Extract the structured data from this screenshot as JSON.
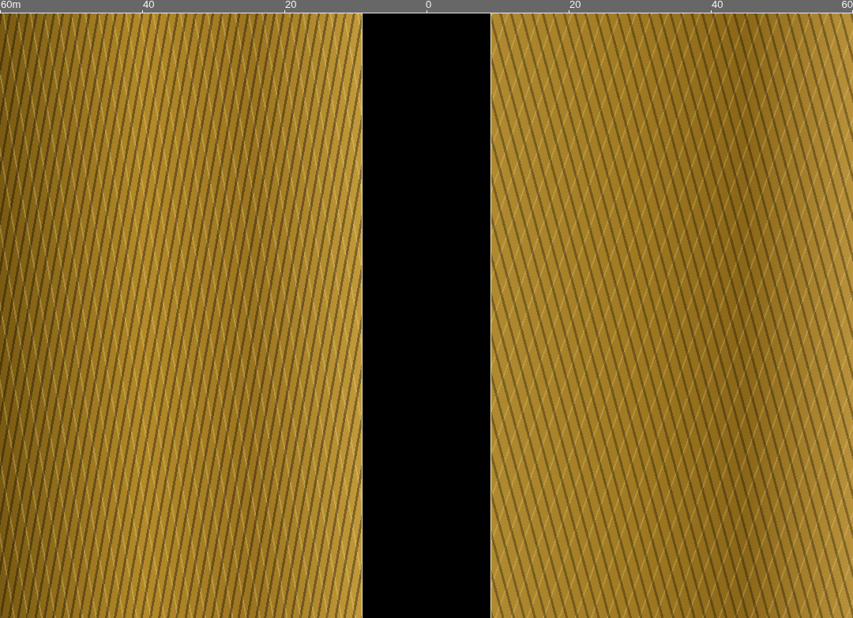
{
  "range_scale": {
    "ticks": [
      {
        "label": "60m"
      },
      {
        "label": "40"
      },
      {
        "label": "20"
      },
      {
        "label": "0"
      },
      {
        "label": "20"
      },
      {
        "label": "40"
      },
      {
        "label": "60"
      }
    ]
  },
  "sonar_view": {
    "panels": [
      {
        "kind": "swath"
      },
      {
        "kind": "water_column"
      },
      {
        "kind": "swath"
      }
    ]
  }
}
